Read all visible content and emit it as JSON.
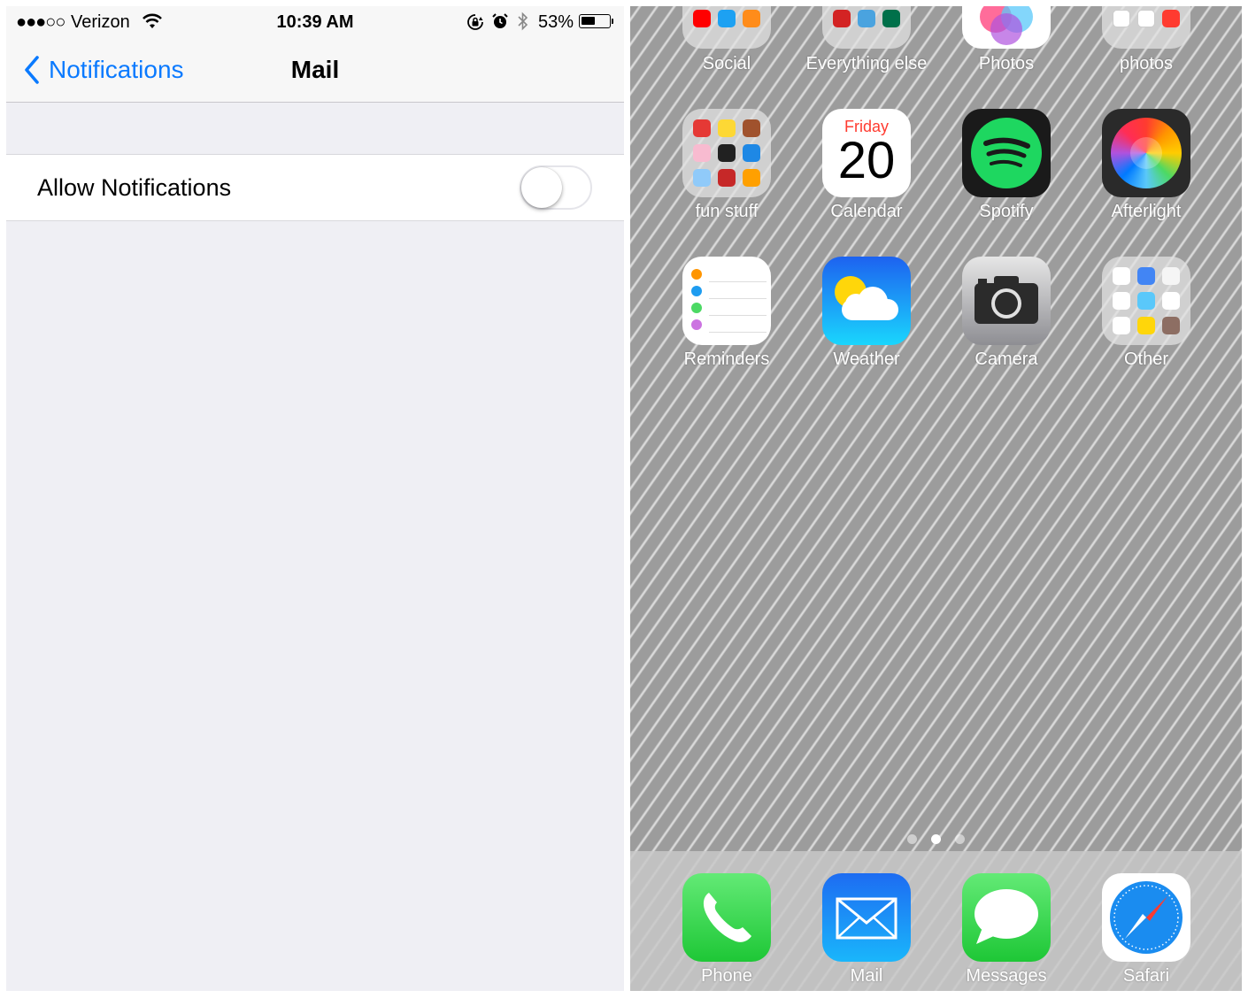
{
  "status_bar": {
    "signal": "●●●○○",
    "carrier": "Verizon",
    "time": "10:39 AM",
    "battery_percent": "53%",
    "battery_level": 0.53
  },
  "settings": {
    "back_label": "Notifications",
    "title": "Mail",
    "allow_label": "Allow Notifications",
    "allow_enabled": false
  },
  "home": {
    "top_row": [
      "Social",
      "Everything else",
      "Photos",
      "photos"
    ],
    "row2": [
      "fun stuff",
      "Calendar",
      "Spotify",
      "Afterlight"
    ],
    "row3": [
      "Reminders",
      "Weather",
      "Camera",
      "Other"
    ],
    "calendar_day": "Friday",
    "calendar_date": "20",
    "page_count": 3,
    "current_page": 2,
    "dock": [
      "Phone",
      "Mail",
      "Messages",
      "Safari"
    ]
  },
  "colors": {
    "ios_blue": "#0a7aff",
    "spotify_green": "#1ed760",
    "calendar_red": "#ff3b30"
  }
}
